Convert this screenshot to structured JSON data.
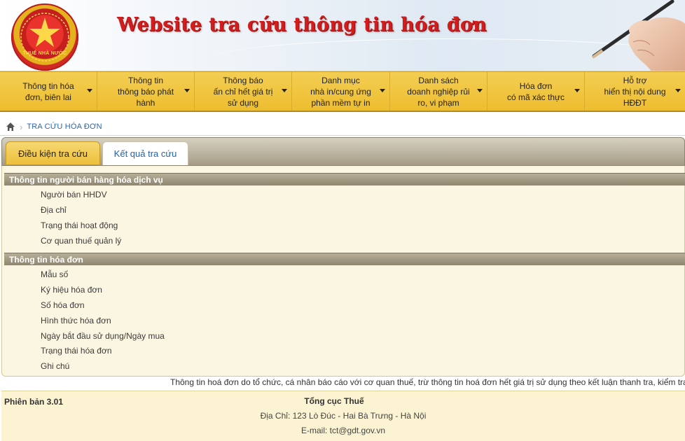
{
  "header": {
    "title": "Website tra cứu thông tin hóa đơn",
    "logo_text": "THUẾ NHÀ NƯỚC",
    "logo_icon": "tax-emblem-icon",
    "illustration": "hand-with-pen"
  },
  "nav": {
    "items": [
      {
        "label": "Thông tin hóa\nđơn, biên lai"
      },
      {
        "label": "Thông tin\nthông báo phát\nhành"
      },
      {
        "label": "Thông báo\nấn chỉ hết giá trị\nsử dụng"
      },
      {
        "label": "Danh mục\nnhà in/cung ứng\nphần mềm tự in"
      },
      {
        "label": "Danh sách\ndoanh nghiệp rủi\nro, vi phạm"
      },
      {
        "label": "Hóa đơn\ncó mã xác thực"
      },
      {
        "label": "Hỗ trợ\nhiển thị nội dung\nHĐĐT"
      }
    ]
  },
  "breadcrumb": {
    "icon": "home-icon",
    "current": "TRA CỨU HÓA ĐƠN"
  },
  "tabs": [
    {
      "label": "Điều kiện tra cứu",
      "active": false
    },
    {
      "label": "Kết quả tra cứu",
      "active": true
    }
  ],
  "seller_section": {
    "title": "Thông tin người bán hàng hóa dịch vụ",
    "fields": [
      "Người bán HHDV",
      "Địa chỉ",
      "Trạng thái hoạt động",
      "Cơ quan thuế quản lý"
    ]
  },
  "invoice_section": {
    "title": "Thông tin hóa đơn",
    "fields": [
      "Mẫu số",
      "Ký hiệu hóa đơn",
      "Số hóa đơn",
      "Hình thức hóa đơn",
      "Ngày bắt đầu sử dụng/Ngày mua",
      "Trạng thái hóa đơn",
      "Ghi chú"
    ]
  },
  "note": "Thông tin hoá đơn do tổ chức, cá nhân báo cáo với cơ quan thuế, trừ thông tin hoá đơn hết giá trị sử dụng theo kết luận thanh tra, kiểm tra",
  "footer": {
    "version": "Phiên bản 3.01",
    "org": "Tổng cục Thuế",
    "address": "Địa Chỉ: 123 Lò Đúc - Hai Bà Trưng - Hà Nội",
    "email": "E-mail: tct@gdt.gov.vn"
  },
  "colors": {
    "nav_bg": "#eebd2f",
    "title_red": "#d11d1d",
    "link_blue": "#2a66b5",
    "section_bar": "#8e866f",
    "panel_bg": "#fbf6e1"
  }
}
